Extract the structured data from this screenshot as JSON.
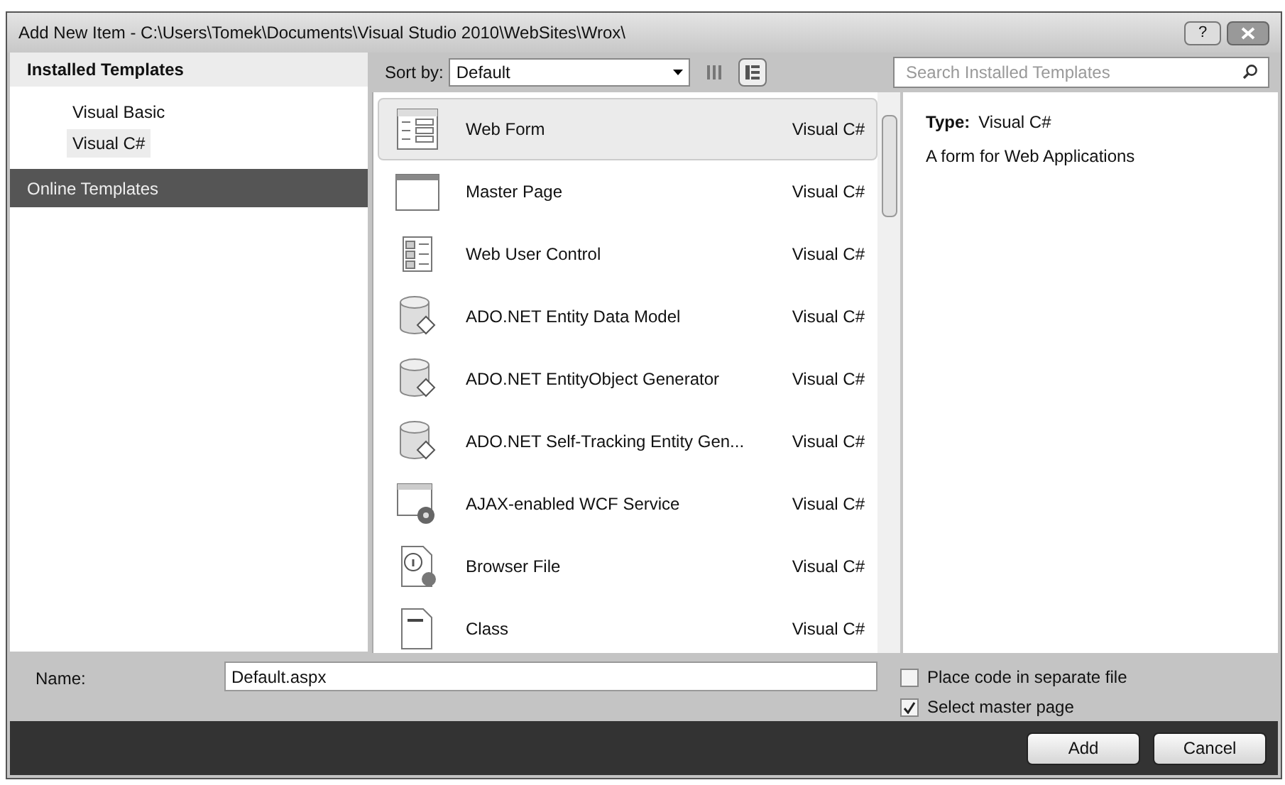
{
  "window": {
    "title": "Add New Item - C:\\Users\\Tomek\\Documents\\Visual Studio 2010\\WebSites\\Wrox\\",
    "help": "?"
  },
  "sidebar": {
    "heading": "Installed Templates",
    "items": [
      {
        "label": "Visual Basic",
        "selected": false
      },
      {
        "label": "Visual C#",
        "selected": true
      }
    ],
    "online": {
      "label": "Online Templates",
      "selected": false
    }
  },
  "toolbar": {
    "sort_label": "Sort by:",
    "sort_value": "Default",
    "views": [
      {
        "kind": "small",
        "selected": false
      },
      {
        "kind": "medium",
        "selected": true
      }
    ]
  },
  "search": {
    "placeholder": "Search Installed Templates"
  },
  "templates": [
    {
      "kind": "webform",
      "name": "Web Form",
      "language": "Visual C#",
      "selected": true
    },
    {
      "kind": "master",
      "name": "Master Page",
      "language": "Visual C#",
      "selected": false
    },
    {
      "kind": "usercontrol",
      "name": "Web User Control",
      "language": "Visual C#",
      "selected": false
    },
    {
      "kind": "database",
      "name": "ADO.NET Entity Data Model",
      "language": "Visual C#",
      "selected": false
    },
    {
      "kind": "database",
      "name": "ADO.NET EntityObject Generator",
      "language": "Visual C#",
      "selected": false
    },
    {
      "kind": "database",
      "name": "ADO.NET Self-Tracking Entity Gen...",
      "language": "Visual C#",
      "selected": false
    },
    {
      "kind": "service",
      "name": "AJAX-enabled WCF Service",
      "language": "Visual C#",
      "selected": false
    },
    {
      "kind": "browser",
      "name": "Browser File",
      "language": "Visual C#",
      "selected": false
    },
    {
      "kind": "class",
      "name": "Class",
      "language": "Visual C#",
      "selected": false
    }
  ],
  "details": {
    "type_label": "Type:",
    "type_value": "Visual C#",
    "description": "A form for Web Applications"
  },
  "name_field": {
    "label": "Name:",
    "value": "Default.aspx"
  },
  "options": [
    {
      "label": "Place code in separate file",
      "checked": false
    },
    {
      "label": "Select master page",
      "checked": true
    }
  ],
  "buttons": [
    {
      "label": "Add"
    },
    {
      "label": "Cancel"
    }
  ]
}
